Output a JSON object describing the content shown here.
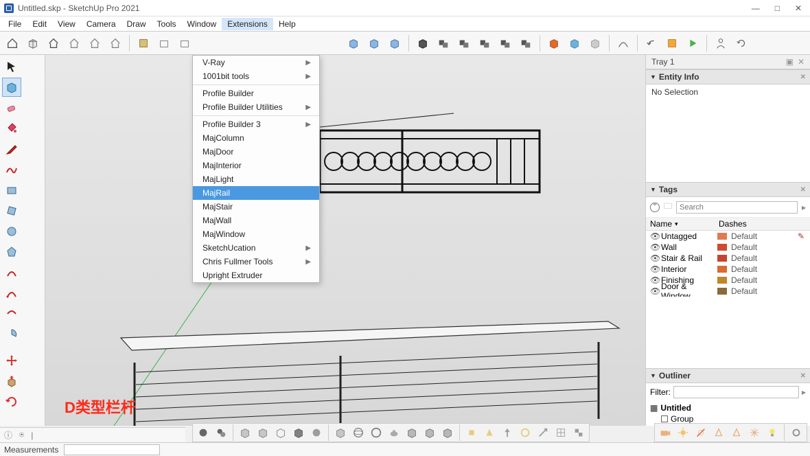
{
  "window": {
    "title": "Untitled.skp - SketchUp Pro 2021",
    "win_buttons": {
      "min": "—",
      "max": "□",
      "close": "✕"
    }
  },
  "menubar": [
    "File",
    "Edit",
    "View",
    "Camera",
    "Draw",
    "Tools",
    "Window",
    "Extensions",
    "Help"
  ],
  "menubar_open_index": 7,
  "extensions_menu": [
    {
      "label": "V-Ray",
      "submenu": true
    },
    {
      "label": "1001bit tools",
      "submenu": true
    },
    {
      "sep": true
    },
    {
      "label": "Profile Builder"
    },
    {
      "label": "Profile Builder Utilities",
      "submenu": true
    },
    {
      "sep": true
    },
    {
      "label": "Profile Builder 3",
      "submenu": true
    },
    {
      "label": "MajColumn"
    },
    {
      "label": "MajDoor"
    },
    {
      "label": "MajInterior"
    },
    {
      "label": "MajLight"
    },
    {
      "label": "MajRail",
      "highlight": true
    },
    {
      "label": "MajStair"
    },
    {
      "label": "MajWall"
    },
    {
      "label": "MajWindow"
    },
    {
      "label": "SketchUcation",
      "submenu": true
    },
    {
      "label": "Chris Fullmer Tools",
      "submenu": true
    },
    {
      "label": "Upright Extruder"
    }
  ],
  "tray": {
    "title": "Tray 1",
    "entity_info": {
      "title": "Entity Info",
      "content": "No Selection"
    },
    "tags": {
      "title": "Tags",
      "search_placeholder": "Search",
      "col_name": "Name",
      "col_dashes": "Dashes",
      "rows": [
        {
          "name": "Untagged",
          "color": "#e07b4f",
          "dash": "Default",
          "pen": true
        },
        {
          "name": "Wall",
          "color": "#d04a2e",
          "dash": "Default"
        },
        {
          "name": "Stair & Rail",
          "color": "#c6442f",
          "dash": "Default"
        },
        {
          "name": "Interior",
          "color": "#d96a33",
          "dash": "Default"
        },
        {
          "name": "Finishing",
          "color": "#c28529",
          "dash": "Default"
        },
        {
          "name": "Door & Window",
          "color": "#8a6a3c",
          "dash": "Default"
        }
      ]
    },
    "outliner": {
      "title": "Outliner",
      "filter_label": "Filter:",
      "filter_value": "",
      "root": "Untitled",
      "child": "Group"
    }
  },
  "measurements": {
    "label": "Measurements",
    "value": ""
  },
  "annotation": "D类型栏杆"
}
